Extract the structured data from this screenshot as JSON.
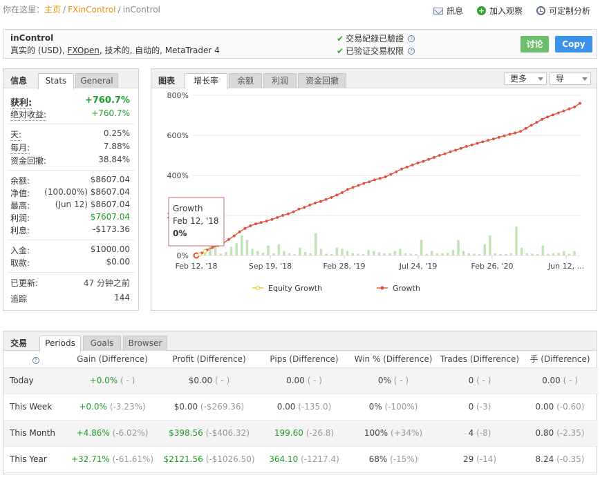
{
  "breadcrumb": {
    "prefix": "你在这里：",
    "home": "主页",
    "section": "FXinControl",
    "current": "inControl"
  },
  "top_actions": [
    {
      "icon": "mail-icon",
      "label": "訊息"
    },
    {
      "icon": "plus-circle-icon",
      "label": "加入观察"
    },
    {
      "icon": "clock-icon",
      "label": "可定制分析"
    }
  ],
  "account": {
    "name": "inControl",
    "desc_prefix": "真实的 (USD),",
    "broker": "FXOpen",
    "desc_suffix": ", 技术的, 自动的, MetaTrader 4",
    "verify_1": "交易紀錄已驗證",
    "verify_2": "已验证交易权限",
    "discuss_label": "讨论",
    "copy_label": "Copy"
  },
  "info_panel": {
    "title": "信息",
    "tabs": [
      "Stats",
      "General"
    ],
    "rows": {
      "gain_k": "获利:",
      "gain_v": "+760.7%",
      "abs_gain_k": "绝对收益:",
      "abs_gain_v": "+760.7%",
      "daily_k": "天:",
      "daily_v": "0.25%",
      "monthly_k": "每月:",
      "monthly_v": "7.88%",
      "drawdown_k": "资金回撤:",
      "drawdown_v": "38.84%",
      "balance_k": "余额:",
      "balance_v": "$8607.04",
      "equity_k": "净值:",
      "equity_v": "(100.00%) $8607.04",
      "highest_k": "最高:",
      "highest_v": "(Jun 12) $8607.04",
      "profit_k": "利润:",
      "profit_v": "$7607.04",
      "interest_k": "利息:",
      "interest_v": "-$173.36",
      "deposits_k": "入金:",
      "deposits_v": "$1000.00",
      "withdrawals_k": "取款:",
      "withdrawals_v": "$0.00",
      "updated_k": "已更新:",
      "updated_v": "47 分钟之前",
      "tracking_k": "追踪",
      "tracking_v": "144"
    }
  },
  "chart_panel": {
    "title": "图表",
    "tabs": [
      "增长率",
      "余额",
      "利润",
      "资金回撤"
    ],
    "more_label": "更多",
    "export_label": "导",
    "tooltip": {
      "series": "Growth",
      "date": "Feb 12, '18",
      "value": "0%"
    }
  },
  "chart_data": {
    "type": "line",
    "y_ticks": [
      "800%",
      "600%",
      "400%",
      "200%",
      "0%"
    ],
    "ylim": [
      0,
      800
    ],
    "x_ticks": [
      "Feb 12, '18",
      "Sep 19, '18",
      "Feb 28, '19",
      "Jul 24, '19",
      "Feb 26, '20",
      "Jun 12, ..."
    ],
    "legend": [
      "Equity Growth",
      "Growth"
    ],
    "grid": true,
    "colors": {
      "growth": "#e0503c",
      "equity_growth": "#f0c020",
      "bars": "#bfe3b4"
    },
    "series": [
      {
        "name": "Growth",
        "values": [
          0,
          12,
          28,
          40,
          50,
          62,
          80,
          98,
          118,
          135,
          148,
          158,
          165,
          172,
          180,
          190,
          200,
          208,
          218,
          232,
          240,
          252,
          262,
          270,
          280,
          290,
          302,
          314,
          330,
          340,
          350,
          360,
          368,
          378,
          385,
          393,
          405,
          418,
          432,
          442,
          452,
          462,
          470,
          480,
          490,
          500,
          508,
          518,
          526,
          535,
          545,
          552,
          560,
          568,
          575,
          582,
          590,
          598,
          605,
          612,
          620,
          635,
          650,
          665,
          680,
          692,
          702,
          712,
          722,
          732,
          742,
          760
        ]
      },
      {
        "name": "Bars",
        "values": [
          12,
          25,
          50,
          70,
          8,
          15,
          40,
          55,
          90,
          70,
          30,
          20,
          12,
          45,
          10,
          50,
          20,
          10,
          6,
          35,
          15,
          10,
          100,
          30,
          8,
          6,
          35,
          30,
          20,
          10,
          8,
          6,
          25,
          20,
          15,
          10,
          10,
          20,
          30,
          10,
          8,
          6,
          70,
          8,
          20,
          10,
          10,
          12,
          25,
          70,
          20,
          10,
          8,
          6,
          50,
          90,
          10,
          6,
          6,
          10,
          130,
          35,
          10,
          8,
          6,
          45,
          8,
          10,
          12,
          20,
          8,
          20
        ]
      }
    ]
  },
  "trades_panel": {
    "title": "交易",
    "tabs": [
      "Periods",
      "Goals",
      "Browser"
    ],
    "columns": [
      "Gain (Difference)",
      "Profit (Difference)",
      "Pips (Difference)",
      "Win % (Difference)",
      "Trades (Difference)",
      "手 (Difference)"
    ],
    "rows": [
      {
        "label": "Today",
        "gain": "+0.0%",
        "gain_d": "( - )",
        "profit": "$0.00",
        "profit_d": "( - )",
        "pips": "0.00",
        "pips_d": "( - )",
        "win": "0%",
        "win_d": "( - )",
        "trades": "0",
        "trades_d": "( - )",
        "lots": "0.00",
        "lots_d": "( - )"
      },
      {
        "label": "This Week",
        "gain": "+0.0%",
        "gain_d": "(-3.23%)",
        "profit": "$0.00",
        "profit_d": "(-$269.36)",
        "pips": "0.00",
        "pips_d": "(-135.0)",
        "win": "0%",
        "win_d": "(-100%)",
        "trades": "0",
        "trades_d": "(-3)",
        "lots": "0.00",
        "lots_d": "(-0.60)"
      },
      {
        "label": "This Month",
        "gain": "+4.86%",
        "gain_d": "(-6.02%)",
        "profit": "$398.56",
        "profit_d": "(-$406.32)",
        "pips": "199.60",
        "pips_d": "(-26.8)",
        "win": "100%",
        "win_d": "(+34%)",
        "trades": "4",
        "trades_d": "(-8)",
        "lots": "0.80",
        "lots_d": "(-2.35)"
      },
      {
        "label": "This Year",
        "gain": "+32.71%",
        "gain_d": "(-61.61%)",
        "profit": "$2121.56",
        "profit_d": "(-$1026.50)",
        "pips": "364.10",
        "pips_d": "(-1217.4)",
        "win": "68%",
        "win_d": "(-15%)",
        "trades": "29",
        "trades_d": "(-14)",
        "lots": "8.24",
        "lots_d": "(-0.35)"
      }
    ]
  }
}
